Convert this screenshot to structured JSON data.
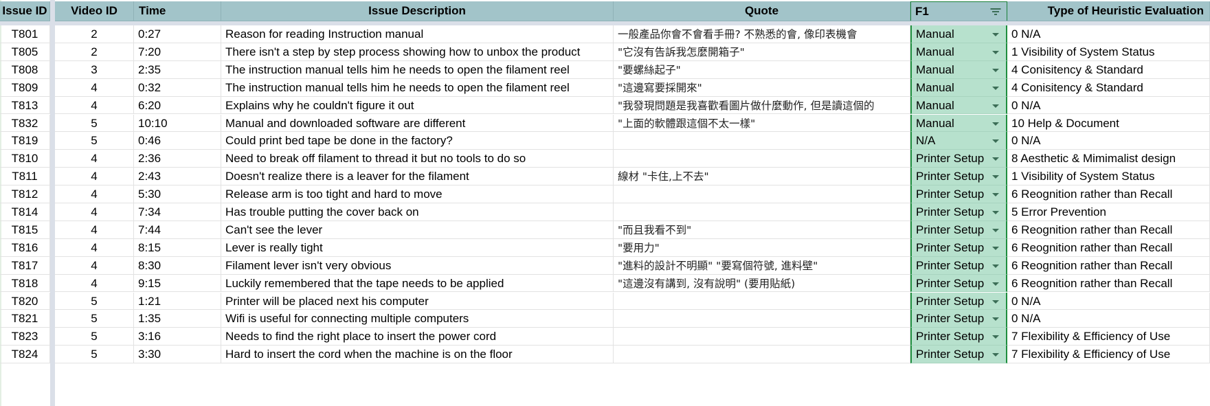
{
  "headers": {
    "issue_id": "Issue ID",
    "video_id": "Video ID",
    "time": "Time",
    "description": "Issue Description",
    "quote": "Quote",
    "f1": "F1",
    "type": "Type of Heuristic Evaluation"
  },
  "icons": {
    "filter": "filter-icon",
    "dropdown": "dropdown-arrow-icon"
  },
  "colors": {
    "header_bg": "#a2c4c9",
    "f1_bg": "#b7e1cd",
    "f1_border": "#1e8e3e",
    "freeze_divider": "#dadfe8"
  },
  "rows": [
    {
      "issue_id": "T801",
      "video_id": "2",
      "time": "0:27",
      "description": "Reason for reading Instruction manual",
      "quote": "一般產品你會不會看手冊? 不熟悉的會, 像印表機會",
      "f1": "Manual",
      "type": "0 N/A"
    },
    {
      "issue_id": "T805",
      "video_id": "2",
      "time": "7:20",
      "description": "There isn't a step by step process showing how to unbox the product",
      "quote": "\"它沒有告訴我怎麼開箱子\"",
      "f1": "Manual",
      "type": "1 Visibility of System Status"
    },
    {
      "issue_id": "T808",
      "video_id": "3",
      "time": "2:35",
      "description": "The instruction manual tells him he needs to open the filament reel",
      "quote": "\"要螺絲起子\"",
      "f1": "Manual",
      "type": "4 Conisitency & Standard"
    },
    {
      "issue_id": "T809",
      "video_id": "4",
      "time": "0:32",
      "description": "The instruction manual tells him he needs to open the filament reel",
      "quote": "\"這邊寫要採開來\"",
      "f1": "Manual",
      "type": "4 Conisitency & Standard"
    },
    {
      "issue_id": "T813",
      "video_id": "4",
      "time": "6:20",
      "description": "Explains why he couldn't figure it out",
      "quote": "\"我發現問題是我喜歡看圖片做什麼動作, 但是讀這個的",
      "f1": "Manual",
      "type": "0 N/A"
    },
    {
      "issue_id": "T832",
      "video_id": "5",
      "time": "10:10",
      "description": "Manual and downloaded software are different",
      "quote": "\"上面的軟體跟這個不太一樣\"",
      "f1": "Manual",
      "type": "10 Help & Document"
    },
    {
      "issue_id": "T819",
      "video_id": "5",
      "time": "0:46",
      "description": "Could print bed tape be done in the factory?",
      "quote": "",
      "f1": "N/A",
      "type": "0 N/A"
    },
    {
      "issue_id": "T810",
      "video_id": "4",
      "time": "2:36",
      "description": "Need to break off filament to thread it but no tools to do so",
      "quote": "",
      "f1": "Printer Setup",
      "type": "8 Aesthetic & Mimimalist design"
    },
    {
      "issue_id": "T811",
      "video_id": "4",
      "time": "2:43",
      "description": "Doesn't realize there is a leaver for the filament",
      "quote": "線材 \"卡住,上不去\"",
      "f1": "Printer Setup",
      "type": "1 Visibility of System Status"
    },
    {
      "issue_id": "T812",
      "video_id": "4",
      "time": "5:30",
      "description": "Release arm is too tight and hard to move",
      "quote": "",
      "f1": "Printer Setup",
      "type": "6 Reognition rather than Recall"
    },
    {
      "issue_id": "T814",
      "video_id": "4",
      "time": "7:34",
      "description": "Has trouble putting the cover back on",
      "quote": "",
      "f1": "Printer Setup",
      "type": "5 Error Prevention"
    },
    {
      "issue_id": "T815",
      "video_id": "4",
      "time": "7:44",
      "description": "Can't see the lever",
      "quote": "\"而且我看不到\"",
      "f1": "Printer Setup",
      "type": "6 Reognition rather than Recall"
    },
    {
      "issue_id": "T816",
      "video_id": "4",
      "time": "8:15",
      "description": "Lever is really tight",
      "quote": "\"要用力\"",
      "f1": "Printer Setup",
      "type": "6 Reognition rather than Recall"
    },
    {
      "issue_id": "T817",
      "video_id": "4",
      "time": "8:30",
      "description": "Filament lever isn't very obvious",
      "quote": "\"進料的設計不明顯\" \"要寫個符號, 進料壁\"",
      "f1": "Printer Setup",
      "type": "6 Reognition rather than Recall"
    },
    {
      "issue_id": "T818",
      "video_id": "4",
      "time": "9:15",
      "description": "Luckily remembered that the tape needs to be applied",
      "quote": "\"這邊沒有講到, 沒有說明\" (要用貼紙)",
      "f1": "Printer Setup",
      "type": "6 Reognition rather than Recall"
    },
    {
      "issue_id": "T820",
      "video_id": "5",
      "time": "1:21",
      "description": "Printer will be placed next his computer",
      "quote": "",
      "f1": "Printer Setup",
      "type": "0 N/A"
    },
    {
      "issue_id": "T821",
      "video_id": "5",
      "time": "1:35",
      "description": "Wifi is useful for connecting multiple computers",
      "quote": "",
      "f1": "Printer Setup",
      "type": "0 N/A"
    },
    {
      "issue_id": "T823",
      "video_id": "5",
      "time": "3:16",
      "description": "Needs to find the right place to insert the power cord",
      "quote": "",
      "f1": "Printer Setup",
      "type": "7 Flexibility & Efficiency of Use"
    },
    {
      "issue_id": "T824",
      "video_id": "5",
      "time": "3:30",
      "description": "Hard to insert the cord when the machine is on the floor",
      "quote": "",
      "f1": "Printer Setup",
      "type": "7 Flexibility & Efficiency of Use"
    }
  ]
}
